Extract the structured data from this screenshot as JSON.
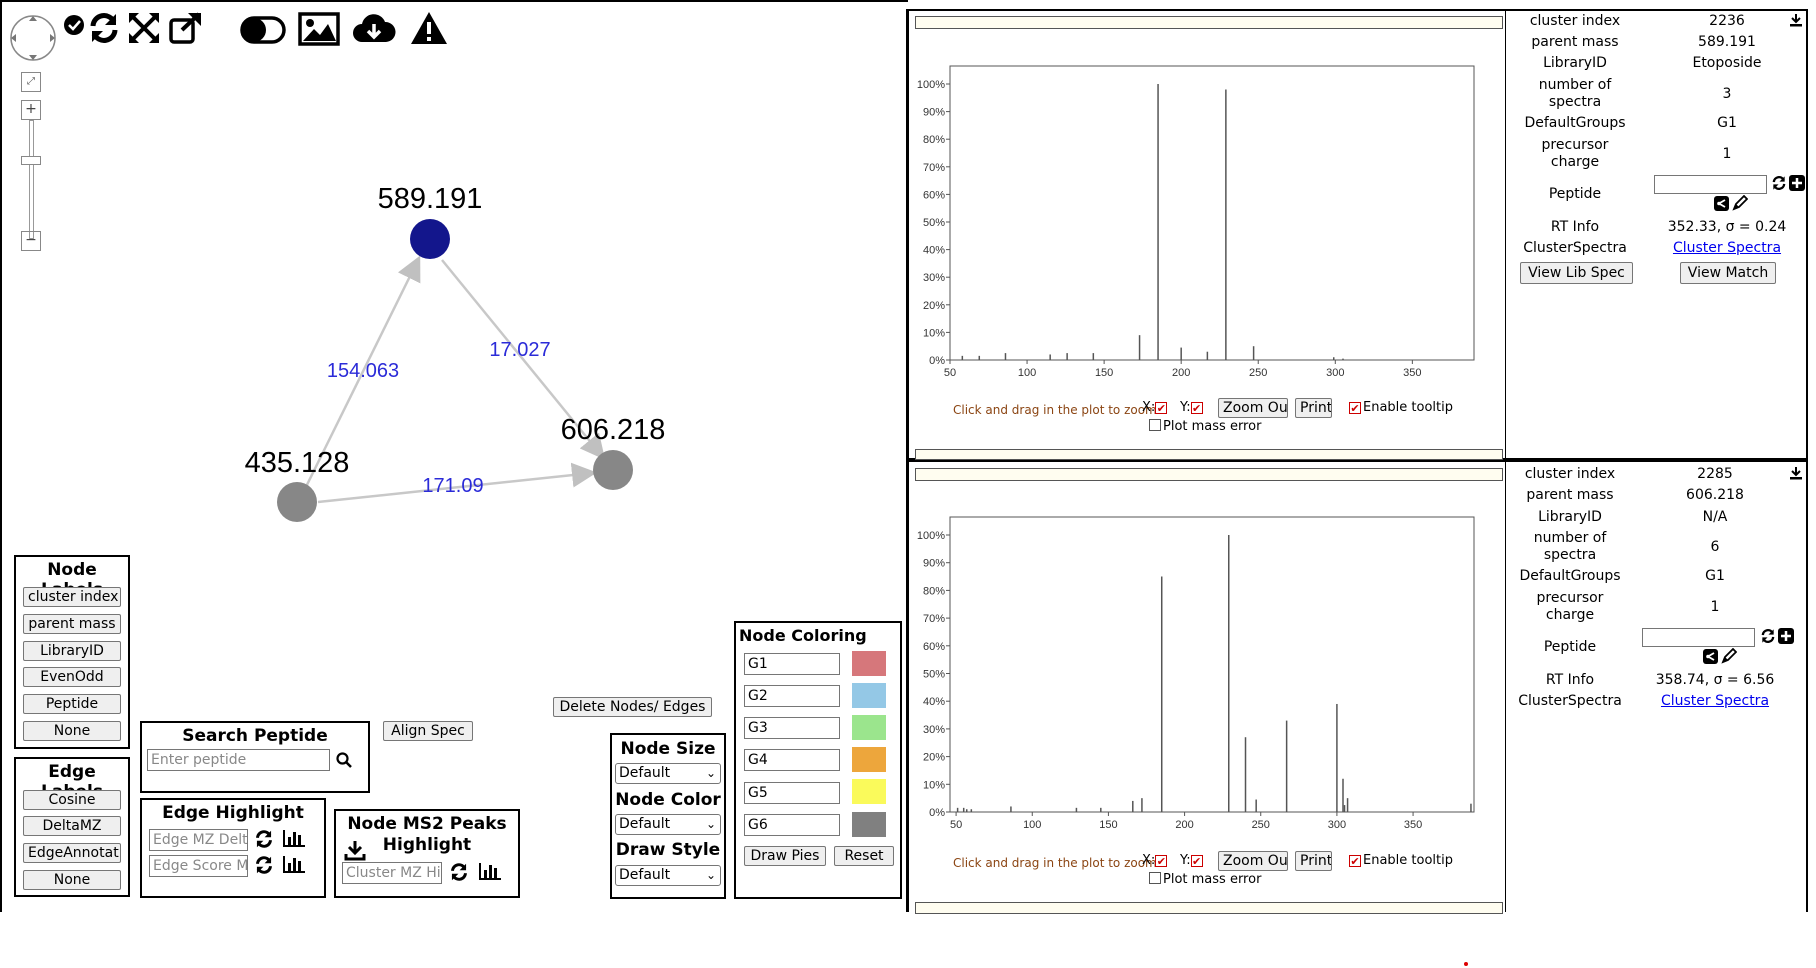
{
  "network": {
    "nodes": [
      {
        "label": "589.191",
        "color": "#13168c"
      },
      {
        "label": "606.218",
        "color": "#878787"
      },
      {
        "label": "435.128",
        "color": "#878787"
      }
    ],
    "edges": [
      {
        "label": "154.063"
      },
      {
        "label": "17.027"
      },
      {
        "label": "171.09"
      }
    ],
    "edge_label_color": "#2b2bd8"
  },
  "node_labels": {
    "title": "Node Labels",
    "buttons": [
      "cluster index",
      "parent mass",
      "LibraryID",
      "EvenOdd",
      "Peptide",
      "None"
    ]
  },
  "edge_labels": {
    "title": "Edge Labels",
    "buttons": [
      "Cosine",
      "DeltaMZ",
      "EdgeAnnotat",
      "None"
    ]
  },
  "search_peptide": {
    "title": "Search Peptide",
    "placeholder": "Enter peptide"
  },
  "align_spec": "Align Spec",
  "delete_nodes": "Delete Nodes/ Edges",
  "edge_highlight": {
    "title": "Edge Highlight",
    "mz_placeholder": "Edge MZ Delta",
    "score_placeholder": "Edge Score Mi"
  },
  "ms2_highlight": {
    "title_line1": "Node MS2 Peaks",
    "title_line2": "Highlight",
    "placeholder": "Cluster MZ Hig"
  },
  "node_style": {
    "size_title": "Node Size",
    "size_value": "Default",
    "color_title": "Node Color",
    "color_value": "Default",
    "draw_title": "Draw Style",
    "draw_value": "Default"
  },
  "node_coloring": {
    "title": "Node Coloring",
    "groups": [
      {
        "name": "G1",
        "color": "#d6777b"
      },
      {
        "name": "G2",
        "color": "#94c8e6"
      },
      {
        "name": "G3",
        "color": "#9be58d"
      },
      {
        "name": "G4",
        "color": "#eda63c"
      },
      {
        "name": "G5",
        "color": "#fafa5b"
      },
      {
        "name": "G6",
        "color": "#808080"
      }
    ],
    "draw_pies": "Draw Pies",
    "reset": "Reset"
  },
  "plot_controls": {
    "zoom_hint": "Click and drag in the plot to zoom",
    "x": "X:",
    "y": "Y:",
    "zoom_out": "Zoom Out",
    "print": "Print",
    "tooltip": "Enable tooltip",
    "mass_error": "Plot mass error"
  },
  "spectrum_top": {
    "info": {
      "cluster_index_label": "cluster index",
      "cluster_index": "2236",
      "parent_mass_label": "parent mass",
      "parent_mass": "589.191",
      "library_id_label": "LibraryID",
      "library_id": "Etoposide",
      "num_spectra_label1": "number of",
      "num_spectra_label2": "spectra",
      "num_spectra": "3",
      "default_groups_label": "DefaultGroups",
      "default_groups": "G1",
      "precursor_label1": "precursor",
      "precursor_label2": "charge",
      "precursor_charge": "1",
      "peptide_label": "Peptide",
      "rt_label": "RT Info",
      "rt": "352.33, σ = 0.24",
      "cluster_spectra_label": "ClusterSpectra",
      "cluster_spectra_link": "Cluster Spectra",
      "view_lib_spec": "View Lib Spec",
      "view_match": "View Match"
    }
  },
  "spectrum_bottom": {
    "info": {
      "cluster_index_label": "cluster index",
      "cluster_index": "2285",
      "parent_mass_label": "parent mass",
      "parent_mass": "606.218",
      "library_id_label": "LibraryID",
      "library_id": "N/A",
      "num_spectra_label1": "number of",
      "num_spectra_label2": "spectra",
      "num_spectra": "6",
      "default_groups_label": "DefaultGroups",
      "default_groups": "G1",
      "precursor_label1": "precursor",
      "precursor_label2": "charge",
      "precursor_charge": "1",
      "peptide_label": "Peptide",
      "rt_label": "RT Info",
      "rt": "358.74, σ = 6.56",
      "cluster_spectra_label": "ClusterSpectra",
      "cluster_spectra_link": "Cluster Spectra"
    }
  },
  "chart_data": [
    {
      "type": "bar",
      "title": "",
      "xlabel": "",
      "ylabel": "",
      "xlim": [
        50,
        390
      ],
      "ylim": [
        0,
        100
      ],
      "xticks": [
        50,
        100,
        150,
        200,
        250,
        300,
        350
      ],
      "yticks": [
        "0%",
        "10%",
        "20%",
        "30%",
        "40%",
        "50%",
        "60%",
        "70%",
        "80%",
        "90%",
        "100%"
      ],
      "grid": false,
      "peaks": [
        {
          "x": 58,
          "y": 1.5
        },
        {
          "x": 69,
          "y": 1.5
        },
        {
          "x": 86,
          "y": 2.5
        },
        {
          "x": 115,
          "y": 2
        },
        {
          "x": 126,
          "y": 2.5
        },
        {
          "x": 143,
          "y": 2.5
        },
        {
          "x": 173,
          "y": 9
        },
        {
          "x": 185,
          "y": 100
        },
        {
          "x": 200,
          "y": 4.5
        },
        {
          "x": 217,
          "y": 3
        },
        {
          "x": 229,
          "y": 98
        },
        {
          "x": 247,
          "y": 5
        },
        {
          "x": 299,
          "y": 1
        },
        {
          "x": 305,
          "y": 0.5
        }
      ]
    },
    {
      "type": "bar",
      "title": "",
      "xlabel": "",
      "ylabel": "",
      "xlim": [
        46,
        390
      ],
      "ylim": [
        0,
        100
      ],
      "xticks": [
        50,
        100,
        150,
        200,
        250,
        300,
        350
      ],
      "yticks": [
        "0%",
        "10%",
        "20%",
        "30%",
        "40%",
        "50%",
        "60%",
        "70%",
        "80%",
        "90%",
        "100%"
      ],
      "grid": false,
      "peaks": [
        {
          "x": 51,
          "y": 1.5
        },
        {
          "x": 55,
          "y": 1.5
        },
        {
          "x": 57,
          "y": 1
        },
        {
          "x": 60,
          "y": 1
        },
        {
          "x": 86,
          "y": 2
        },
        {
          "x": 129,
          "y": 1.5
        },
        {
          "x": 145,
          "y": 1.5
        },
        {
          "x": 166,
          "y": 4
        },
        {
          "x": 172,
          "y": 5
        },
        {
          "x": 185,
          "y": 85
        },
        {
          "x": 229,
          "y": 100
        },
        {
          "x": 240,
          "y": 27
        },
        {
          "x": 247,
          "y": 4.5
        },
        {
          "x": 267,
          "y": 33
        },
        {
          "x": 300,
          "y": 39
        },
        {
          "x": 304,
          "y": 12
        },
        {
          "x": 305,
          "y": 2.5
        },
        {
          "x": 307,
          "y": 5
        },
        {
          "x": 388,
          "y": 3
        }
      ]
    }
  ]
}
